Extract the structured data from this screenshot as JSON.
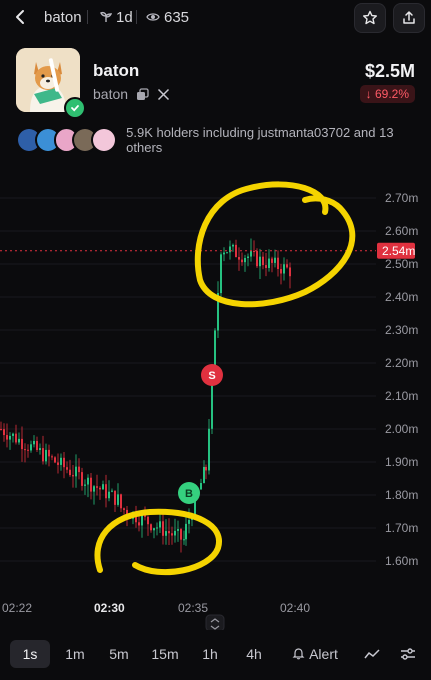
{
  "topbar": {
    "token_name": "baton",
    "age": "1d",
    "views": "635"
  },
  "token": {
    "name": "baton",
    "ticker": "baton",
    "market_cap": "$2.5M",
    "change": "↓ 69.2%"
  },
  "holders": {
    "text": "5.9K holders including justmanta03702 and 13 others"
  },
  "chart_data": {
    "type": "candlestick",
    "y_ticks": [
      "2.70m",
      "2.60m",
      "2.50m",
      "2.40m",
      "2.30m",
      "2.20m",
      "2.10m",
      "2.00m",
      "1.90m",
      "1.80m",
      "1.70m",
      "1.60m"
    ],
    "x_ticks": [
      "02:22",
      "02:30",
      "02:35",
      "02:40"
    ],
    "current_price": "2.54m",
    "markers": [
      {
        "label": "B",
        "color": "#35d07f"
      },
      {
        "label": "S",
        "color": "#e0313f"
      }
    ],
    "colors": {
      "up": "#26c281",
      "down": "#e0313f",
      "annotation": "#f5d400"
    }
  },
  "timeframes": [
    "1s",
    "1m",
    "5m",
    "15m",
    "1h",
    "4h"
  ],
  "toolbar": {
    "alert_label": "Alert"
  }
}
